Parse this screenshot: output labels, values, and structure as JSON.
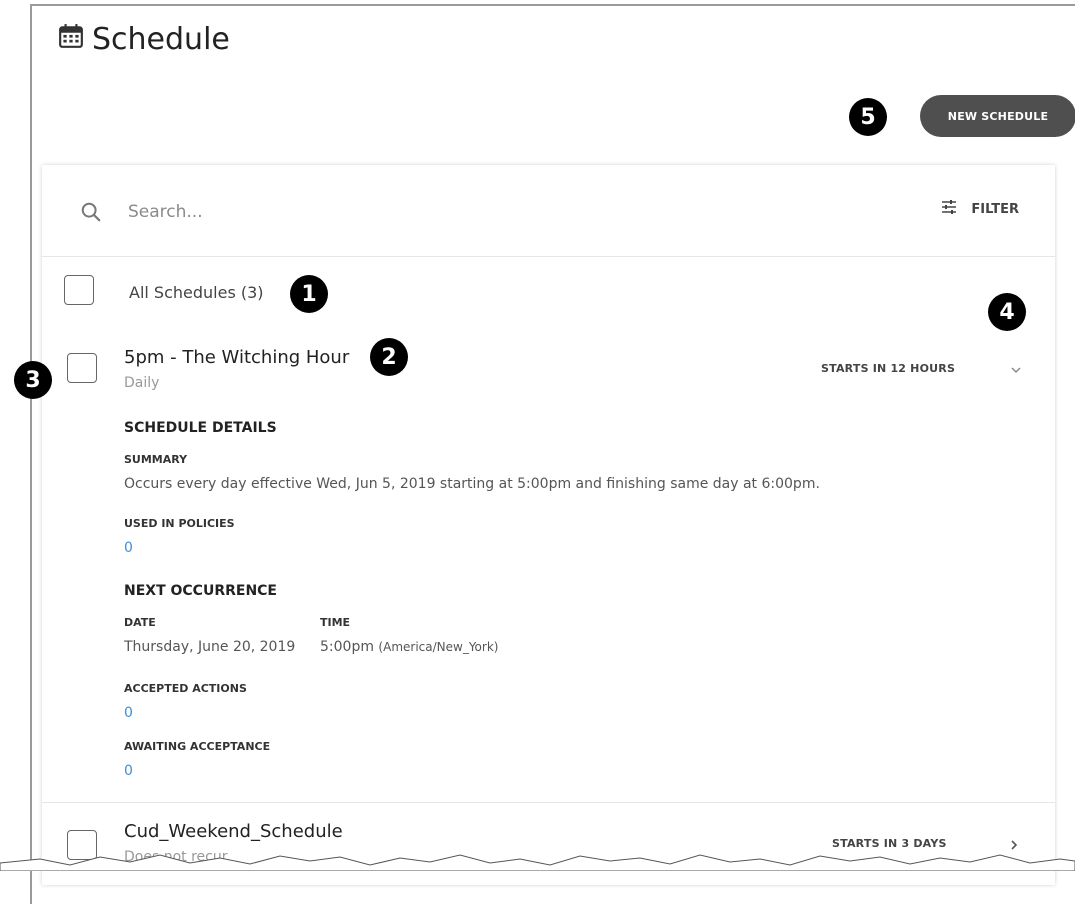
{
  "page": {
    "title": "Schedule",
    "new_button": "NEW SCHEDULE"
  },
  "search": {
    "placeholder": "Search..."
  },
  "filter": {
    "label": "FILTER"
  },
  "all_schedules": {
    "label": "All Schedules (3)"
  },
  "schedules": [
    {
      "name": "5pm - The Witching Hour",
      "recurrence": "Daily",
      "starts": "STARTS IN 12 HOURS",
      "expanded": true,
      "details": {
        "heading": "SCHEDULE DETAILS",
        "summary_label": "SUMMARY",
        "summary": "Occurs every day effective Wed, Jun 5, 2019 starting at 5:00pm and finishing same day at 6:00pm.",
        "used_in_policies_label": "USED IN POLICIES",
        "used_in_policies": "0",
        "next_occurrence_label": "NEXT OCCURRENCE",
        "date_label": "DATE",
        "date": "Thursday, June 20, 2019",
        "time_label": "TIME",
        "time": "5:00pm",
        "timezone": "(America/New_York)",
        "accepted_actions_label": "ACCEPTED ACTIONS",
        "accepted_actions": "0",
        "awaiting_acceptance_label": "AWAITING ACCEPTANCE",
        "awaiting_acceptance": "0"
      }
    },
    {
      "name": "Cud_Weekend_Schedule",
      "recurrence": "Does not recur",
      "starts": "STARTS IN 3 DAYS",
      "expanded": false
    }
  ],
  "callouts": [
    "1",
    "2",
    "3",
    "4",
    "5"
  ],
  "colors": {
    "button_bg": "#4f4f4f",
    "link": "#3d8fd6",
    "callout_bg": "#000000"
  },
  "icons": [
    "calendar-icon",
    "search-icon",
    "filter-sliders-icon",
    "chevron-down-icon",
    "chevron-right-icon"
  ]
}
